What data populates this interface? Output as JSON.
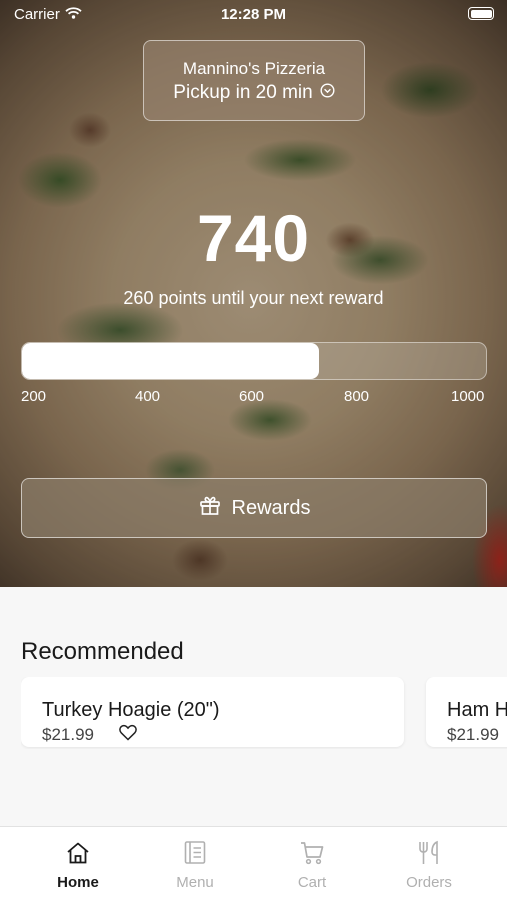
{
  "status_bar": {
    "carrier": "Carrier",
    "time": "12:28 PM"
  },
  "store": {
    "name": "Mannino's Pizzeria",
    "pickup": "Pickup in 20 min"
  },
  "rewards": {
    "points": "740",
    "until_text": "260 points until your next reward",
    "progress_fraction": 0.64,
    "ticks": [
      "200",
      "400",
      "600",
      "800",
      "1000"
    ],
    "button_label": "Rewards"
  },
  "recommended": {
    "title": "Recommended",
    "items": [
      {
        "name": "Turkey Hoagie (20\")",
        "price": "$21.99"
      },
      {
        "name": "Ham H",
        "price": "$21.99"
      }
    ]
  },
  "tabs": [
    {
      "label": "Home",
      "icon": "home-icon",
      "active": true
    },
    {
      "label": "Menu",
      "icon": "menu-icon",
      "active": false
    },
    {
      "label": "Cart",
      "icon": "cart-icon",
      "active": false
    },
    {
      "label": "Orders",
      "icon": "orders-icon",
      "active": false
    }
  ],
  "colors": {
    "active_tab": "#1a1a1a",
    "inactive_tab": "#b0b0b0",
    "background": "#f7f7f7"
  }
}
